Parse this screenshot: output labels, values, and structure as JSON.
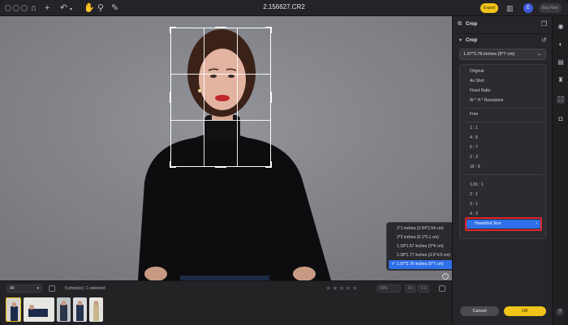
{
  "window": {
    "filename": "2.156627.CR2"
  },
  "toolbar": {
    "export_label": "Export",
    "avatar_letter": "E",
    "buy_label": "Buy Now"
  },
  "crop_panel": {
    "panel_title": "Crop",
    "section_title": "Crop",
    "selected_ratio": "1.97*2.76 inches (5*7 cm)",
    "ratio_options_group1": [
      "Original",
      "As Shot",
      "Fixed Ratio",
      "W * H * Resolution"
    ],
    "ratio_options_group2": [
      "Free"
    ],
    "ratio_options_group3": [
      "1 : 1",
      "4 : 5",
      "5 : 7",
      "2 : 3",
      "16 : 9"
    ],
    "ratio_options_group4": [
      "1.91 : 1",
      "2 : 1",
      "3 : 1",
      "4 : 3"
    ],
    "headshot_label": "Headshot Size",
    "cancel_label": "Cancel",
    "ok_label": "OK"
  },
  "headshot_sizes": {
    "items": [
      "1*1 inches (2.54*2.54 cm)",
      "2*2 inches (5.1*5.1 cm)",
      "1.18*1.57 inches (3*4 cm)",
      "1.38*1.77 inches (3.5*4.5 cm)",
      "1.97*2.76 inches (5*7 cm)"
    ],
    "selected_index": 4
  },
  "filmstrip": {
    "filter_value": "All",
    "photo_count": "5 photo(s) / 1 selected",
    "zoom_value": "83%",
    "btn_fit": "Fit",
    "btn_one": "1:1"
  },
  "icons": {
    "chevron_down": "chevron-down-icon",
    "chevron_right": "chevron-right-icon",
    "check": "check-icon"
  },
  "colors": {
    "accent_yellow": "#f0c419",
    "selection_blue": "#2f6fe8",
    "highlight_red": "#e0262b"
  }
}
